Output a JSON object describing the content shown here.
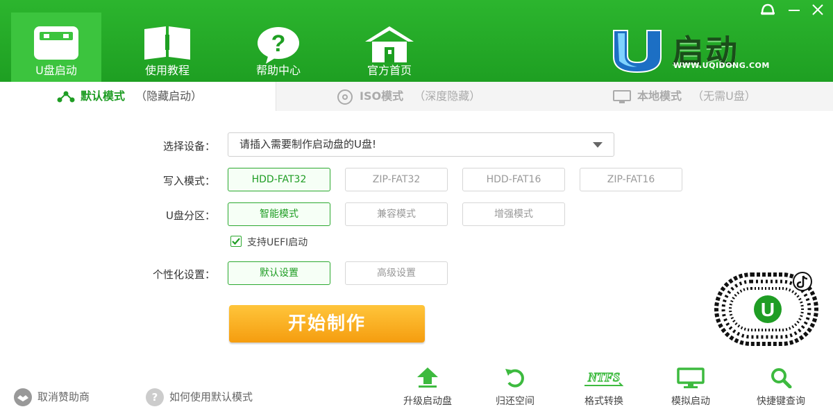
{
  "header": {
    "nav": [
      {
        "label": "U盘启动",
        "icon": "usb-drive-icon",
        "active": true
      },
      {
        "label": "使用教程",
        "icon": "book-icon"
      },
      {
        "label": "帮助中心",
        "icon": "question-icon"
      },
      {
        "label": "官方首页",
        "icon": "home-icon"
      }
    ],
    "logo_text": "启动",
    "logo_sub": "WWW.UQIDONG.COM",
    "window_buttons": [
      "skin-icon",
      "minimize-icon",
      "close-icon"
    ]
  },
  "tabs": [
    {
      "main": "默认模式",
      "sub": "（隐藏启动）",
      "icon": "share-nodes-icon",
      "active": true
    },
    {
      "main": "ISO模式",
      "sub": "（深度隐藏）",
      "icon": "disc-icon"
    },
    {
      "main": "本地模式",
      "sub": "（无需U盘）",
      "icon": "monitor-icon"
    }
  ],
  "form": {
    "device_label": "选择设备：",
    "device_value": "请插入需要制作启动盘的U盘!",
    "write_label": "写入模式：",
    "write_options": [
      "HDD-FAT32",
      "ZIP-FAT32",
      "HDD-FAT16",
      "ZIP-FAT16"
    ],
    "partition_label": "U盘分区：",
    "partition_options": [
      "智能模式",
      "兼容模式",
      "增强模式"
    ],
    "uefi_label": "支持UEFI启动",
    "personal_label": "个性化设置：",
    "personal_options": [
      "默认设置",
      "高级设置"
    ],
    "start_button": "开始制作"
  },
  "footer": {
    "cancel_sponsor": "取消赞助商",
    "how_to": "如何使用默认模式",
    "how_to_icon_text": "?",
    "tools": [
      {
        "label": "升级启动盘",
        "icon": "upload-arrow-icon"
      },
      {
        "label": "归还空间",
        "icon": "restore-icon"
      },
      {
        "label": "格式转换",
        "icon": "ntfs-icon",
        "icon_text": "NTFS"
      },
      {
        "label": "模拟启动",
        "icon": "monitor-icon"
      },
      {
        "label": "快捷键查询",
        "icon": "search-icon"
      }
    ]
  },
  "colors": {
    "brand_green": "#1f9d24",
    "header_green": "#2cb52e",
    "start_orange": "#f59d0f"
  }
}
